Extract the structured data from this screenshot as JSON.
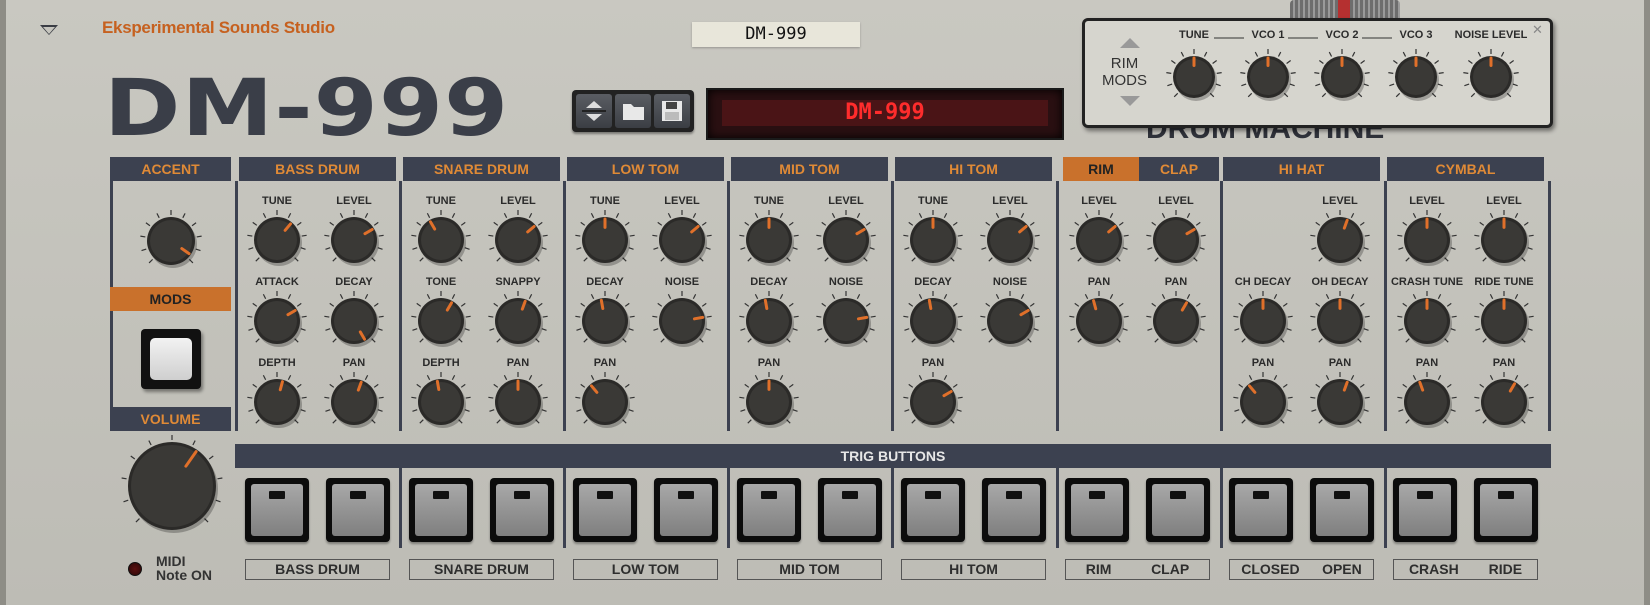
{
  "brand": "Eksperimental Sounds Studio",
  "tape_label": "DM-999",
  "logo": "DM-999",
  "lcd_text": "DM-999",
  "rim_mods": {
    "line1": "RIM",
    "line2": "MODS",
    "knobs": [
      "TUNE",
      "VCO 1",
      "VCO 2",
      "VCO 3",
      "NOISE LEVEL"
    ],
    "angles": [
      0,
      0,
      0,
      0,
      0
    ]
  },
  "ghost_text": "DRUM MACHINE",
  "sections": {
    "accent": "ACCENT",
    "mods": "MODS",
    "volume": "VOLUME",
    "bass_drum": "BASS DRUM",
    "snare_drum": "SNARE DRUM",
    "low_tom": "LOW TOM",
    "mid_tom": "MID TOM",
    "hi_tom": "HI TOM",
    "rim": "RIM",
    "clap": "CLAP",
    "hi_hat": "HI HAT",
    "cymbal": "CYMBAL"
  },
  "knob_labels": {
    "bd": [
      "TUNE",
      "LEVEL",
      "ATTACK",
      "DECAY",
      "DEPTH",
      "PAN"
    ],
    "sd": [
      "TUNE",
      "LEVEL",
      "TONE",
      "SNAPPY",
      "DEPTH",
      "PAN"
    ],
    "lt": [
      "TUNE",
      "LEVEL",
      "DECAY",
      "NOISE",
      "PAN"
    ],
    "mt": [
      "TUNE",
      "LEVEL",
      "DECAY",
      "NOISE",
      "PAN"
    ],
    "ht": [
      "TUNE",
      "LEVEL",
      "DECAY",
      "NOISE",
      "PAN"
    ],
    "rc": [
      "LEVEL",
      "LEVEL",
      "PAN",
      "PAN"
    ],
    "hh": [
      "LEVEL",
      "CH DECAY",
      "OH DECAY",
      "PAN",
      "PAN"
    ],
    "cy": [
      "LEVEL",
      "LEVEL",
      "CRASH TUNE",
      "RIDE TUNE",
      "PAN",
      "PAN"
    ]
  },
  "trig_title": "TRIG BUTTONS",
  "trig_labels": [
    "BASS DRUM",
    "SNARE DRUM",
    "LOW TOM",
    "MID TOM",
    "HI TOM",
    "RIM",
    "CLAP",
    "CLOSED",
    "OPEN",
    "CRASH",
    "RIDE"
  ],
  "midi": {
    "line1": "MIDI",
    "line2": "Note ON"
  }
}
